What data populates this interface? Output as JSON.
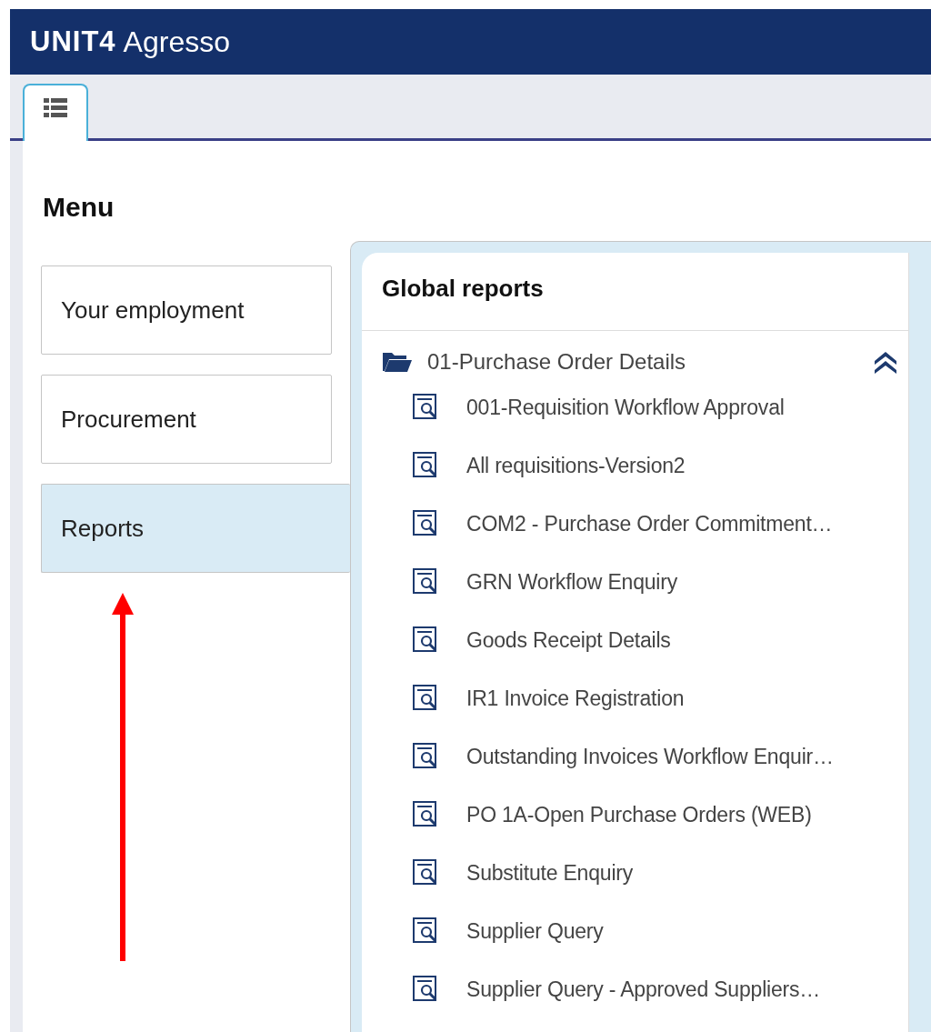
{
  "header": {
    "logo_brand": "UNIT4",
    "logo_product": "Agresso"
  },
  "tabs": [
    {
      "kind": "list",
      "selected": true
    }
  ],
  "menu": {
    "title": "Menu",
    "items": [
      {
        "label": "Your employment",
        "selected": false
      },
      {
        "label": "Procurement",
        "selected": false
      },
      {
        "label": "Reports",
        "selected": true
      }
    ]
  },
  "reports_panel": {
    "title": "Global reports",
    "folders": [
      {
        "label": "01-Purchase Order Details",
        "expanded": true,
        "children": [
          {
            "label": "001-Requisition Workflow Approval"
          },
          {
            "label": "All requisitions-Version2"
          },
          {
            "label": "COM2 - Purchase Order Commitment…"
          },
          {
            "label": "GRN Workflow Enquiry"
          },
          {
            "label": "Goods Receipt Details"
          },
          {
            "label": "IR1 Invoice Registration"
          },
          {
            "label": "Outstanding Invoices Workflow Enquir…"
          },
          {
            "label": "PO 1A-Open Purchase Orders (WEB)"
          },
          {
            "label": "Substitute Enquiry"
          },
          {
            "label": "Supplier Query"
          },
          {
            "label": "Supplier Query - Approved Suppliers…"
          }
        ]
      }
    ]
  }
}
